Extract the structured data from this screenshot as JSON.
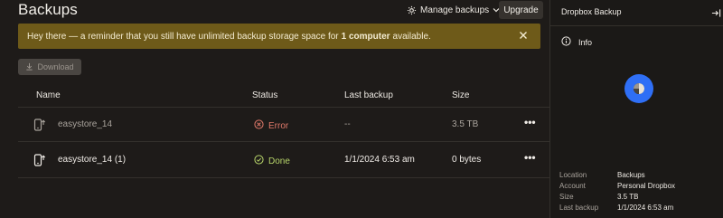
{
  "header": {
    "title": "Backups",
    "manage_label": "Manage backups",
    "upgrade_label": "Upgrade"
  },
  "banner": {
    "text_before": "Hey there — a reminder that you still have unlimited backup storage space for",
    "text_bold": "1 computer",
    "text_after": "available."
  },
  "toolbar": {
    "download_label": "Download"
  },
  "table": {
    "columns": [
      "Name",
      "Status",
      "Last backup",
      "Size"
    ],
    "rows": [
      {
        "name": "easystore_14",
        "status": "Error",
        "last_backup": "--",
        "size": "3.5 TB"
      },
      {
        "name": "easystore_14 (1)",
        "status": "Done",
        "last_backup": "1/1/2024 6:53 am",
        "size": "0 bytes"
      }
    ]
  },
  "panel": {
    "title": "Dropbox Backup",
    "info_label": "Info",
    "details": [
      {
        "key": "Location",
        "value": "Backups"
      },
      {
        "key": "Account",
        "value": "Personal Dropbox"
      },
      {
        "key": "Size",
        "value": "3.5 TB"
      },
      {
        "key": "Last backup",
        "value": "1/1/2024 6:53 am"
      }
    ]
  },
  "colors": {
    "background": "#1e1b19",
    "banner": "#6e5a19",
    "error": "#e0796a",
    "success": "#b7d46a",
    "accent_blue": "#2f6ff6"
  },
  "icons": [
    "gear-icon",
    "chevron-down-icon",
    "close-icon",
    "download-icon",
    "external-drive-icon",
    "error-x-circle-icon",
    "check-circle-icon",
    "more-icon",
    "collapse-panel-icon",
    "info-icon",
    "dropbox-backup-logo"
  ]
}
